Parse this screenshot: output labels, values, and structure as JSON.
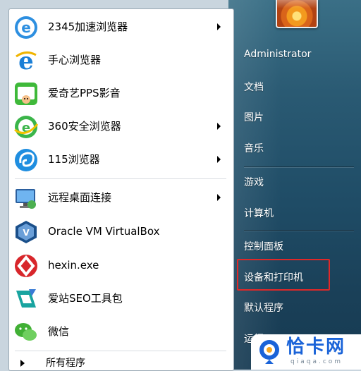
{
  "left_menu": {
    "items": [
      {
        "label": "2345加速浏览器",
        "icon": "2345-browser-icon",
        "has_submenu": true
      },
      {
        "label": "手心浏览器",
        "icon": "shouxin-browser-icon",
        "has_submenu": false
      },
      {
        "label": "爱奇艺PPS影音",
        "icon": "iqiyi-pps-icon",
        "has_submenu": false
      },
      {
        "label": "360安全浏览器",
        "icon": "360-browser-icon",
        "has_submenu": true
      },
      {
        "label": "115浏览器",
        "icon": "115-browser-icon",
        "has_submenu": true
      },
      {
        "label": "远程桌面连接",
        "icon": "remote-desktop-icon",
        "has_submenu": true
      },
      {
        "label": "Oracle VM VirtualBox",
        "icon": "virtualbox-icon",
        "has_submenu": false
      },
      {
        "label": "hexin.exe",
        "icon": "hexin-icon",
        "has_submenu": false
      },
      {
        "label": "爱站SEO工具包",
        "icon": "aizhan-seo-icon",
        "has_submenu": false
      },
      {
        "label": "微信",
        "icon": "wechat-icon",
        "has_submenu": false
      }
    ],
    "all_programs": "所有程序"
  },
  "right_pane": {
    "user_name": "Administrator",
    "items": [
      "文档",
      "图片",
      "音乐",
      "游戏",
      "计算机",
      "控制面板",
      "设备和打印机",
      "默认程序",
      "运行..."
    ],
    "highlighted": "设备和打印机"
  },
  "watermark": {
    "brand": "恰卡网",
    "url": "qiaqa.com"
  },
  "colors": {
    "highlight_border": "#e02828",
    "right_pane": "#1f4c66",
    "watermark_blue": "#1a63d8"
  }
}
